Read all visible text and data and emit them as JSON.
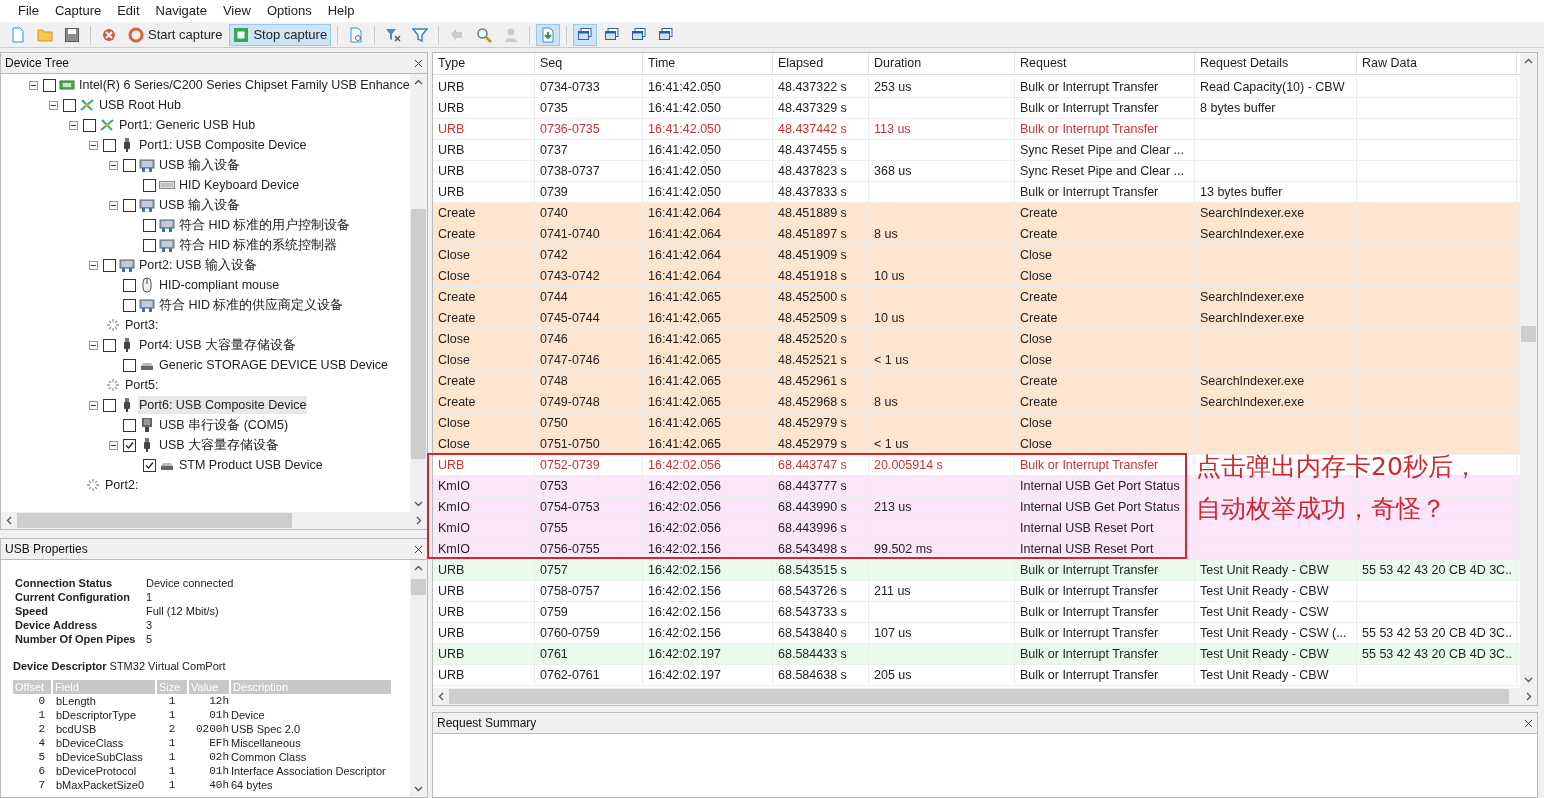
{
  "menu": [
    "File",
    "Capture",
    "Edit",
    "Navigate",
    "View",
    "Options",
    "Help"
  ],
  "toolbar": [
    {
      "kind": "new",
      "pressed": false,
      "disabled": false
    },
    {
      "kind": "open",
      "pressed": false,
      "disabled": false
    },
    {
      "kind": "save",
      "pressed": false,
      "disabled": false
    },
    {
      "kind": "sep"
    },
    {
      "kind": "clear",
      "pressed": false,
      "disabled": false
    },
    {
      "kind": "start",
      "label": "Start capture",
      "pressed": false,
      "disabled": false
    },
    {
      "kind": "stop",
      "label": "Stop capture",
      "pressed": true,
      "disabled": false
    },
    {
      "kind": "sep"
    },
    {
      "kind": "doc",
      "pressed": false,
      "disabled": false
    },
    {
      "kind": "sep"
    },
    {
      "kind": "filterx",
      "pressed": false,
      "disabled": false
    },
    {
      "kind": "filter",
      "pressed": false,
      "disabled": false
    },
    {
      "kind": "sep"
    },
    {
      "kind": "back",
      "pressed": false,
      "disabled": true
    },
    {
      "kind": "find",
      "pressed": false,
      "disabled": false
    },
    {
      "kind": "person",
      "pressed": false,
      "disabled": true
    },
    {
      "kind": "sep"
    },
    {
      "kind": "download",
      "pressed": true,
      "disabled": false
    },
    {
      "kind": "sep"
    },
    {
      "kind": "win",
      "pressed": true,
      "disabled": false
    },
    {
      "kind": "win",
      "pressed": false,
      "disabled": false
    },
    {
      "kind": "win",
      "pressed": false,
      "disabled": false
    },
    {
      "kind": "win",
      "pressed": false,
      "disabled": false
    }
  ],
  "device_tree": {
    "title": "Device Tree",
    "items": [
      {
        "label": "Intel(R) 6 Series/C200 Series Chipset Family USB Enhance",
        "kind": "pci",
        "checked": false,
        "selected": false,
        "expanded": true,
        "children": [
          {
            "label": "USB Root Hub",
            "kind": "hub",
            "checked": false,
            "selected": false,
            "expanded": true,
            "children": [
              {
                "label": "Port1: Generic USB Hub",
                "kind": "hub",
                "checked": false,
                "selected": false,
                "expanded": true,
                "children": [
                  {
                    "label": "Port1: USB Composite Device",
                    "kind": "plug",
                    "checked": false,
                    "selected": false,
                    "expanded": true,
                    "children": [
                      {
                        "label": "USB 输入设备",
                        "kind": "hid",
                        "checked": false,
                        "selected": false,
                        "expanded": true,
                        "children": [
                          {
                            "label": "HID Keyboard Device",
                            "kind": "keyboard",
                            "checked": false,
                            "selected": false
                          }
                        ]
                      },
                      {
                        "label": "USB 输入设备",
                        "kind": "hid",
                        "checked": false,
                        "selected": false,
                        "expanded": true,
                        "children": [
                          {
                            "label": "符合 HID 标准的用户控制设备",
                            "kind": "hid",
                            "checked": false,
                            "selected": false
                          },
                          {
                            "label": "符合 HID 标准的系统控制器",
                            "kind": "hid",
                            "checked": false,
                            "selected": false
                          }
                        ]
                      }
                    ]
                  },
                  {
                    "label": "Port2: USB 输入设备",
                    "kind": "hid",
                    "checked": false,
                    "selected": false,
                    "expanded": true,
                    "children": [
                      {
                        "label": "HID-compliant mouse",
                        "kind": "mouse",
                        "checked": false,
                        "selected": false
                      },
                      {
                        "label": "符合 HID 标准的供应商定义设备",
                        "kind": "hid",
                        "checked": false,
                        "selected": false
                      }
                    ]
                  },
                  {
                    "label": "Port3:",
                    "kind": "empty",
                    "selected": false
                  },
                  {
                    "label": "Port4: USB 大容量存储设备",
                    "kind": "plug",
                    "checked": false,
                    "selected": false,
                    "expanded": true,
                    "children": [
                      {
                        "label": "Generic STORAGE DEVICE USB Device",
                        "kind": "drive",
                        "checked": false,
                        "selected": false
                      }
                    ]
                  },
                  {
                    "label": "Port5:",
                    "kind": "empty",
                    "selected": false
                  },
                  {
                    "label": "Port6: USB Composite Device",
                    "kind": "plug",
                    "checked": false,
                    "selected": true,
                    "expanded": true,
                    "children": [
                      {
                        "label": "USB 串行设备 (COM5)",
                        "kind": "serial",
                        "checked": false,
                        "selected": false
                      },
                      {
                        "label": "USB 大容量存储设备",
                        "kind": "plug",
                        "checked": true,
                        "selected": false,
                        "expanded": true,
                        "children": [
                          {
                            "label": "STM Product USB Device",
                            "kind": "drive",
                            "checked": true,
                            "selected": false
                          }
                        ]
                      }
                    ]
                  }
                ]
              },
              {
                "label": "Port2:",
                "kind": "empty",
                "selected": false
              }
            ]
          }
        ]
      }
    ]
  },
  "usb_properties": {
    "title": "USB Properties",
    "fields": [
      {
        "label": "Connection Status",
        "value": "Device connected"
      },
      {
        "label": "Current Configuration",
        "value": "1"
      },
      {
        "label": "Speed",
        "value": "Full (12 Mbit/s)"
      },
      {
        "label": "Device Address",
        "value": "3"
      },
      {
        "label": "Number Of Open Pipes",
        "value": "5"
      }
    ],
    "descriptor_title": "Device Descriptor",
    "descriptor_name": "STM32 Virtual ComPort",
    "columns": [
      "Offset",
      "Field",
      "Size",
      "Value",
      "Description"
    ],
    "rows": [
      [
        "0",
        "bLength",
        "1",
        "12h"
      ],
      [
        "1",
        "bDescriptorType",
        "1",
        "01h",
        "Device"
      ],
      [
        "2",
        "bcdUSB",
        "2",
        "0200h",
        "USB Spec 2.0"
      ],
      [
        "4",
        "bDeviceClass",
        "1",
        "EFh",
        "Miscellaneous"
      ],
      [
        "5",
        "bDeviceSubClass",
        "1",
        "02h",
        "Common Class"
      ],
      [
        "6",
        "bDeviceProtocol",
        "1",
        "01h",
        "Interface Association Descriptor"
      ],
      [
        "7",
        "bMaxPacketSize0",
        "1",
        "40h",
        "64 bytes"
      ]
    ]
  },
  "log": {
    "columns": [
      "Type",
      "Seq",
      "Time",
      "Elapsed",
      "Duration",
      "Request",
      "Request Details",
      "Raw Data"
    ],
    "rows": [
      {
        "kind": "urb",
        "error": false,
        "type": "URB",
        "seq": "0734-0733",
        "time": "16:41:42.050",
        "elapsed": "48.437322 s",
        "duration": "253 us",
        "request": "Bulk or Interrupt Transfer",
        "details": "Read Capacity(10) - CBW"
      },
      {
        "kind": "urb",
        "error": false,
        "type": "URB",
        "seq": "0735",
        "time": "16:41:42.050",
        "elapsed": "48.437329 s",
        "request": "Bulk or Interrupt Transfer",
        "details": "8 bytes buffer"
      },
      {
        "kind": "urb",
        "error": true,
        "type": "URB",
        "seq": "0736-0735",
        "time": "16:41:42.050",
        "elapsed": "48.437442 s",
        "duration": "113 us",
        "request": "Bulk or Interrupt Transfer"
      },
      {
        "kind": "urb",
        "error": false,
        "type": "URB",
        "seq": "0737",
        "time": "16:41:42.050",
        "elapsed": "48.437455 s",
        "request": "Sync Reset Pipe and Clear ..."
      },
      {
        "kind": "urb",
        "error": false,
        "type": "URB",
        "seq": "0738-0737",
        "time": "16:41:42.050",
        "elapsed": "48.437823 s",
        "duration": "368 us",
        "request": "Sync Reset Pipe and Clear ..."
      },
      {
        "kind": "urb",
        "error": false,
        "type": "URB",
        "seq": "0739",
        "time": "16:41:42.050",
        "elapsed": "48.437833 s",
        "request": "Bulk or Interrupt Transfer",
        "details": "13 bytes buffer"
      },
      {
        "kind": "file",
        "error": false,
        "type": "Create",
        "seq": "0740",
        "time": "16:41:42.064",
        "elapsed": "48.451889 s",
        "request": "Create",
        "details": "SearchIndexer.exe"
      },
      {
        "kind": "file",
        "error": false,
        "type": "Create",
        "seq": "0741-0740",
        "time": "16:41:42.064",
        "elapsed": "48.451897 s",
        "duration": "8 us",
        "request": "Create",
        "details": "SearchIndexer.exe"
      },
      {
        "kind": "file",
        "error": false,
        "type": "Close",
        "seq": "0742",
        "time": "16:41:42.064",
        "elapsed": "48.451909 s",
        "request": "Close"
      },
      {
        "kind": "file",
        "error": false,
        "type": "Close",
        "seq": "0743-0742",
        "time": "16:41:42.064",
        "elapsed": "48.451918 s",
        "duration": "10 us",
        "request": "Close"
      },
      {
        "kind": "file",
        "error": false,
        "type": "Create",
        "seq": "0744",
        "time": "16:41:42.065",
        "elapsed": "48.452500 s",
        "request": "Create",
        "details": "SearchIndexer.exe"
      },
      {
        "kind": "file",
        "error": false,
        "type": "Create",
        "seq": "0745-0744",
        "time": "16:41:42.065",
        "elapsed": "48.452509 s",
        "duration": "10 us",
        "request": "Create",
        "details": "SearchIndexer.exe"
      },
      {
        "kind": "file",
        "error": false,
        "type": "Close",
        "seq": "0746",
        "time": "16:41:42.065",
        "elapsed": "48.452520 s",
        "request": "Close"
      },
      {
        "kind": "file",
        "error": false,
        "type": "Close",
        "seq": "0747-0746",
        "time": "16:41:42.065",
        "elapsed": "48.452521 s",
        "duration": "< 1 us",
        "request": "Close"
      },
      {
        "kind": "file",
        "error": false,
        "type": "Create",
        "seq": "0748",
        "time": "16:41:42.065",
        "elapsed": "48.452961 s",
        "request": "Create",
        "details": "SearchIndexer.exe"
      },
      {
        "kind": "file",
        "error": false,
        "type": "Create",
        "seq": "0749-0748",
        "time": "16:41:42.065",
        "elapsed": "48.452968 s",
        "duration": "8 us",
        "request": "Create",
        "details": "SearchIndexer.exe"
      },
      {
        "kind": "file",
        "error": false,
        "type": "Close",
        "seq": "0750",
        "time": "16:41:42.065",
        "elapsed": "48.452979 s",
        "request": "Close"
      },
      {
        "kind": "file",
        "error": false,
        "type": "Close",
        "seq": "0751-0750",
        "time": "16:41:42.065",
        "elapsed": "48.452979 s",
        "duration": "< 1 us",
        "request": "Close"
      },
      {
        "kind": "urb",
        "error": true,
        "type": "URB",
        "seq": "0752-0739",
        "time": "16:42:02.056",
        "elapsed": "68.443747 s",
        "duration": "20.005914 s",
        "request": "Bulk or Interrupt Transfer"
      },
      {
        "kind": "kmio",
        "error": false,
        "type": "KmIO",
        "seq": "0753",
        "time": "16:42:02.056",
        "elapsed": "68.443777 s",
        "request": "Internal USB Get Port Status"
      },
      {
        "kind": "kmio",
        "error": false,
        "type": "KmIO",
        "seq": "0754-0753",
        "time": "16:42:02.056",
        "elapsed": "68.443990 s",
        "duration": "213 us",
        "request": "Internal USB Get Port Status"
      },
      {
        "kind": "kmio",
        "error": false,
        "type": "KmIO",
        "seq": "0755",
        "time": "16:42:02.056",
        "elapsed": "68.443996 s",
        "request": "Internal USB Reset Port"
      },
      {
        "kind": "kmio",
        "error": false,
        "type": "KmIO",
        "seq": "0756-0755",
        "time": "16:42:02.156",
        "elapsed": "68.543498 s",
        "duration": "99.502 ms",
        "request": "Internal USB Reset Port"
      },
      {
        "kind": "data",
        "error": false,
        "type": "URB",
        "seq": "0757",
        "time": "16:42:02.156",
        "elapsed": "68.543515 s",
        "request": "Bulk or Interrupt Transfer",
        "details": "Test Unit Ready - CBW",
        "raw": "55 53 42 43 20 CB 4D 3C.."
      },
      {
        "kind": "urb",
        "error": false,
        "type": "URB",
        "seq": "0758-0757",
        "time": "16:42:02.156",
        "elapsed": "68.543726 s",
        "duration": "211 us",
        "request": "Bulk or Interrupt Transfer",
        "details": "Test Unit Ready - CBW"
      },
      {
        "kind": "urb",
        "error": false,
        "type": "URB",
        "seq": "0759",
        "time": "16:42:02.156",
        "elapsed": "68.543733 s",
        "request": "Bulk or Interrupt Transfer",
        "details": "Test Unit Ready - CSW"
      },
      {
        "kind": "urb",
        "error": false,
        "type": "URB",
        "seq": "0760-0759",
        "time": "16:42:02.156",
        "elapsed": "68.543840 s",
        "duration": "107 us",
        "request": "Bulk or Interrupt Transfer",
        "details": "Test Unit Ready - CSW (...",
        "raw": "55 53 42 53 20 CB 4D 3C.."
      },
      {
        "kind": "data",
        "error": false,
        "type": "URB",
        "seq": "0761",
        "time": "16:42:02.197",
        "elapsed": "68.584433 s",
        "request": "Bulk or Interrupt Transfer",
        "details": "Test Unit Ready - CBW",
        "raw": "55 53 42 43 20 CB 4D 3C.."
      },
      {
        "kind": "urb",
        "error": false,
        "type": "URB",
        "seq": "0762-0761",
        "time": "16:42:02.197",
        "elapsed": "68.584638 s",
        "duration": "205 us",
        "request": "Bulk or Interrupt Transfer",
        "details": "Test Unit Ready - CBW"
      }
    ]
  },
  "annotation": {
    "lines": [
      "点击弹出内存卡20秒后，",
      "自动枚举成功，奇怪？"
    ]
  },
  "request_summary": {
    "title": "Request Summary"
  }
}
